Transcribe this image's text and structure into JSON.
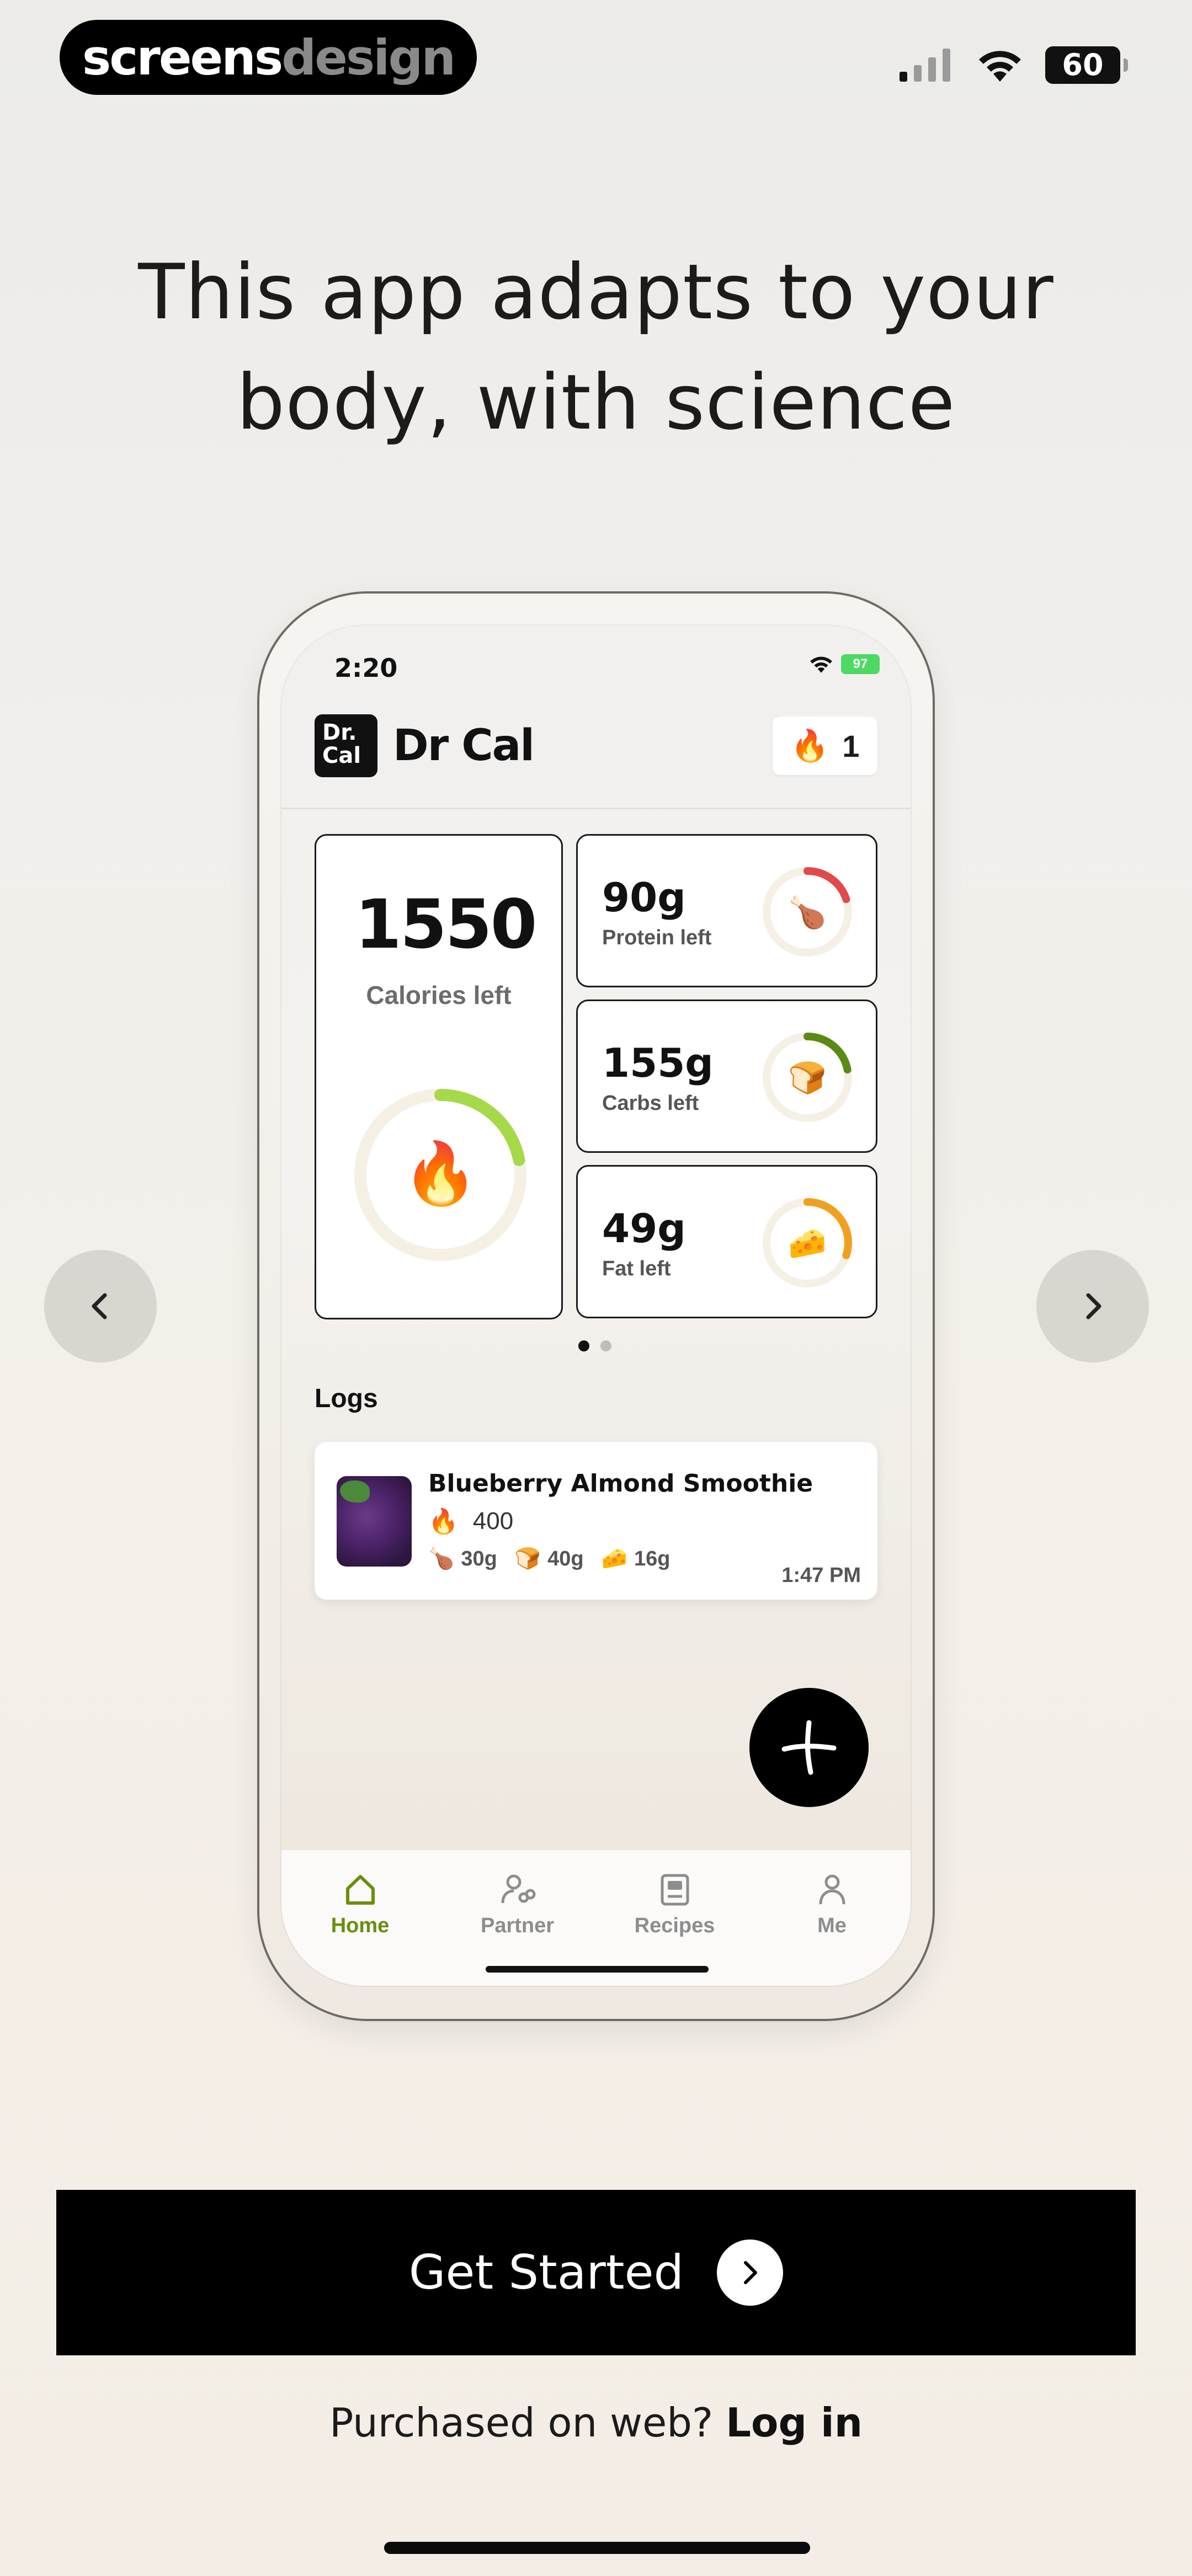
{
  "status_bar": {
    "brand_part1": "screens",
    "brand_part2": "design",
    "battery": "60"
  },
  "headline": {
    "line1": "This app adapts to your",
    "line2": "body, with science"
  },
  "phone": {
    "time": "2:20",
    "battery": "97",
    "app": {
      "logo_line1": "Dr.",
      "logo_line2": "Cal",
      "name": "Dr Cal",
      "streak_icon": "flame-icon",
      "streak_count": "1"
    },
    "calories": {
      "value": "1550",
      "label": "Calories left",
      "progress_fraction": 0.22,
      "ring_color": "#a6d94a"
    },
    "macros": [
      {
        "value": "90g",
        "label": "Protein left",
        "icon": "drumstick-icon",
        "color": "#e04a4a",
        "progress_fraction": 0.2
      },
      {
        "value": "155g",
        "label": "Carbs left",
        "icon": "bread-icon",
        "color": "#5a8a16",
        "progress_fraction": 0.22
      },
      {
        "value": "49g",
        "label": "Fat left",
        "icon": "cheese-icon",
        "color": "#f0a021",
        "progress_fraction": 0.3
      }
    ],
    "logs_title": "Logs",
    "log_item": {
      "name": "Blueberry Almond Smoothie",
      "calories": "400",
      "protein": "30g",
      "carbs": "40g",
      "fat": "16g",
      "time": "1:47 PM"
    },
    "tabs": [
      {
        "label": "Home",
        "icon": "home-icon",
        "active": true
      },
      {
        "label": "Partner",
        "icon": "partner-icon",
        "active": false
      },
      {
        "label": "Recipes",
        "icon": "recipes-icon",
        "active": false
      },
      {
        "label": "Me",
        "icon": "person-icon",
        "active": false
      }
    ]
  },
  "cta": {
    "label": "Get Started"
  },
  "login": {
    "prompt": "Purchased on web?",
    "link": "Log in"
  },
  "colors": {
    "accent_green": "#6a8e10",
    "cta_bg": "#000000"
  }
}
